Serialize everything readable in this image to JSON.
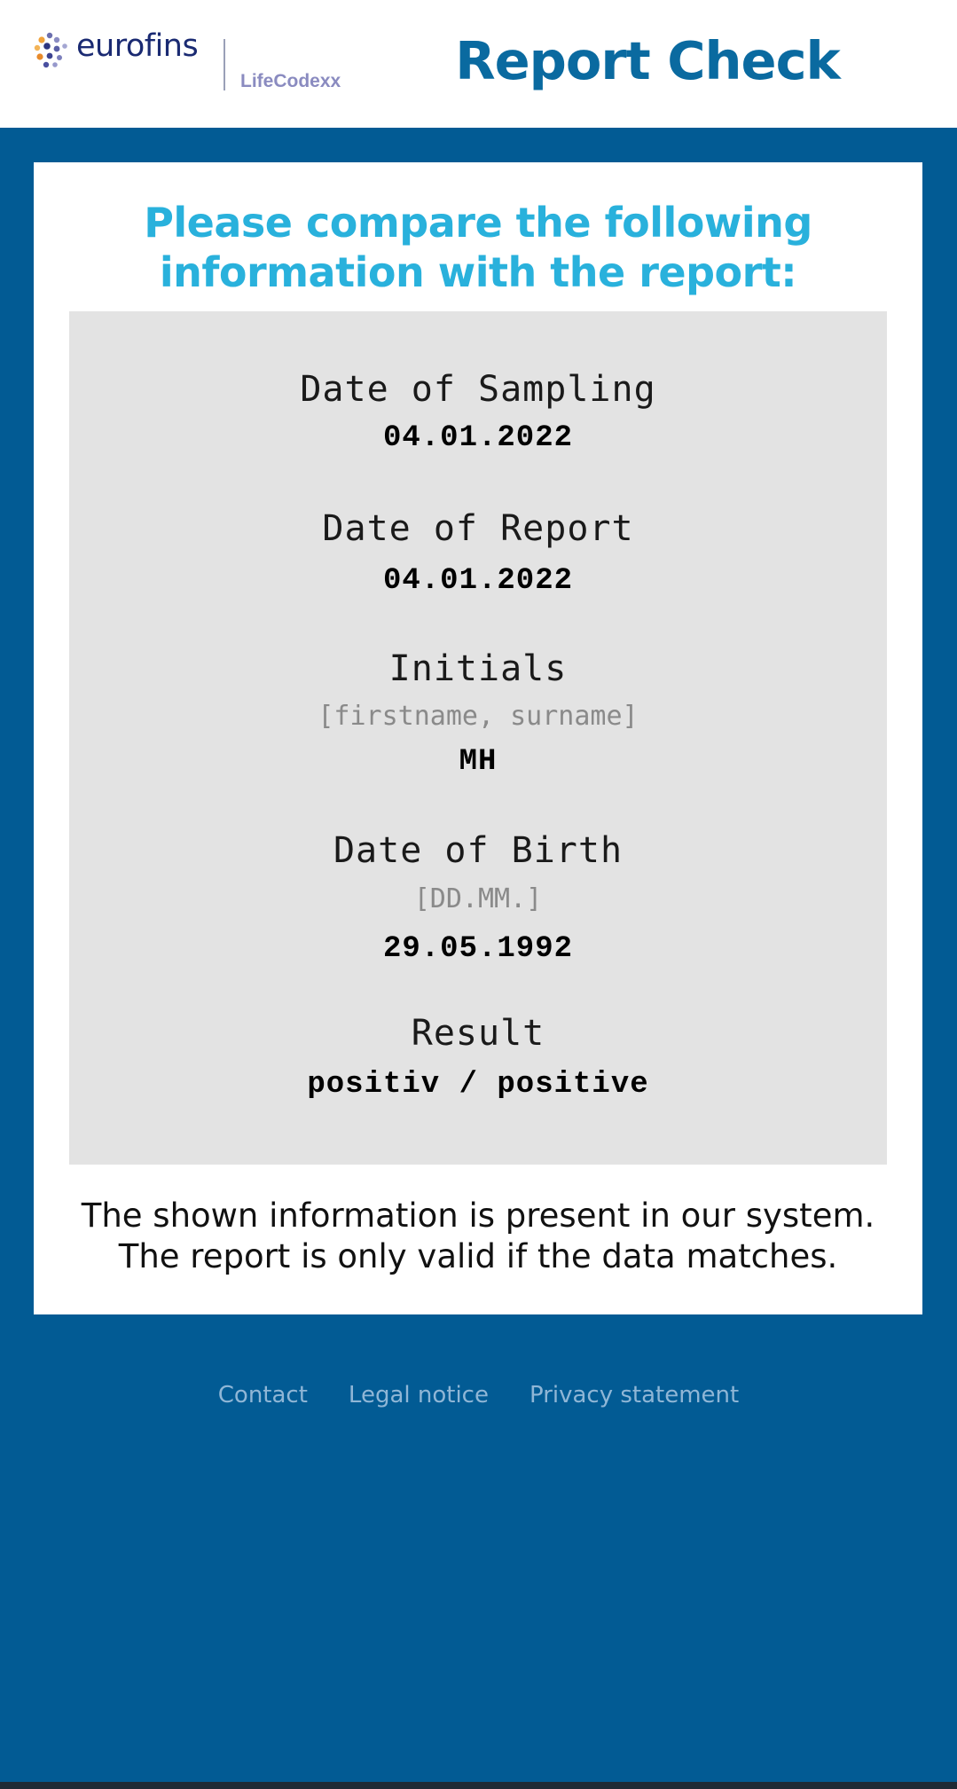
{
  "header": {
    "logo_word": "eurofins",
    "logo_sub": "LifeCodexx",
    "title": "Report Check"
  },
  "card": {
    "heading_line1": "Please compare the following",
    "heading_line2": "information with the report:",
    "fields": [
      {
        "label": "Date of Sampling",
        "hint": "",
        "value": "04.01.2022"
      },
      {
        "label": "Date of Report",
        "hint": "",
        "value": "04.01.2022"
      },
      {
        "label": "Initials",
        "hint": "[firstname, surname]",
        "value": "MH"
      },
      {
        "label": "Date of Birth",
        "hint": "[DD.MM.]",
        "value": "29.05.1992"
      },
      {
        "label": "Result",
        "hint": "",
        "value": "positiv / positive"
      }
    ],
    "note_line1": "The shown information is present in our system.",
    "note_line2": "The report is only valid if the data matches."
  },
  "footer": {
    "links": [
      "Contact",
      "Legal notice",
      "Privacy statement"
    ]
  },
  "colors": {
    "background": "#025b94",
    "title": "#0a6aa0",
    "heading": "#29b1dc",
    "panel": "#e3e3e3",
    "footer_link": "#8fb6d6"
  }
}
